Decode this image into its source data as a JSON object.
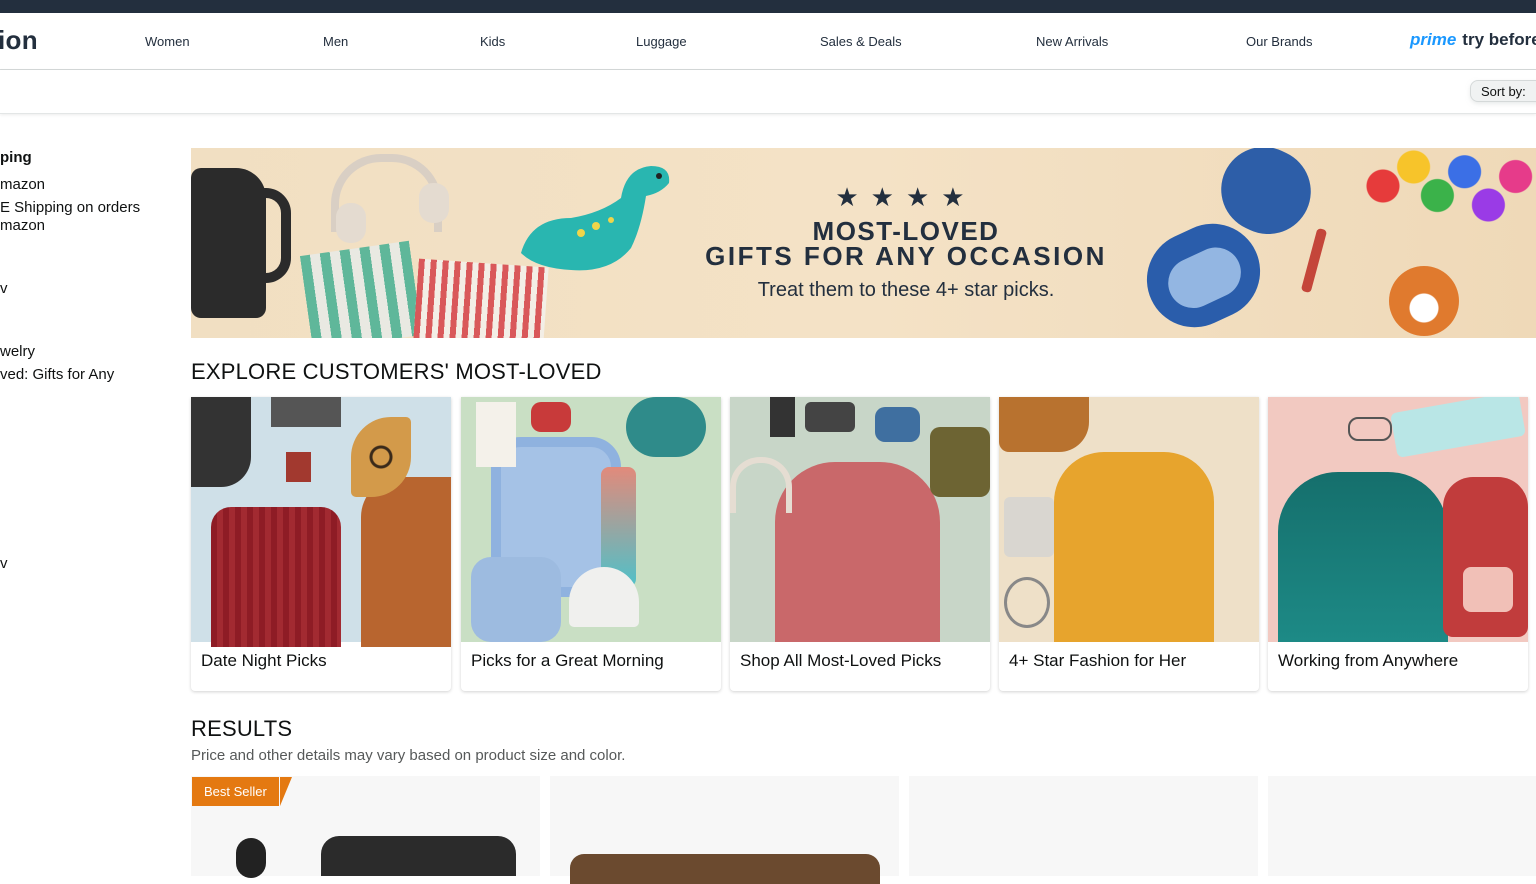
{
  "header": {
    "logo_text": "ion",
    "nav_items": [
      "Women",
      "Men",
      "Kids",
      "Luggage",
      "Sales & Deals",
      "New Arrivals",
      "Our Brands"
    ],
    "prime_label": "prime",
    "prime_suffix": "try before"
  },
  "sortbar": {
    "sort_label": "Sort by:"
  },
  "sidebar": {
    "heading": "ping",
    "items": [
      "mazon",
      "E Shipping on orders",
      "mazon",
      "v",
      "welry",
      "ved: Gifts for Any",
      "v"
    ]
  },
  "hero": {
    "stars": "★★★★",
    "line1": "MOST-LOVED",
    "line2": "GIFTS FOR ANY OCCASION",
    "line3": "Treat them to these 4+ star picks."
  },
  "explore": {
    "heading": "EXPLORE CUSTOMERS' MOST-LOVED",
    "cards": [
      {
        "label": "Date Night Picks",
        "bg": "#cfe0e8"
      },
      {
        "label": "Picks for a Great Morning",
        "bg": "#c9dfc4"
      },
      {
        "label": "Shop All Most-Loved Picks",
        "bg": "#c8d6c8"
      },
      {
        "label": "4+ Star Fashion for Her",
        "bg": "#eee0c8"
      },
      {
        "label": "Working from Anywhere",
        "bg": "#f2c9c1"
      }
    ]
  },
  "results": {
    "heading": "RESULTS",
    "subtext": "Price and other details may vary based on product size and color.",
    "badge": "Best Seller"
  },
  "colors": {
    "topbar": "#232f3e",
    "prime_blue": "#1a98ff",
    "badge_orange": "#e47911"
  }
}
